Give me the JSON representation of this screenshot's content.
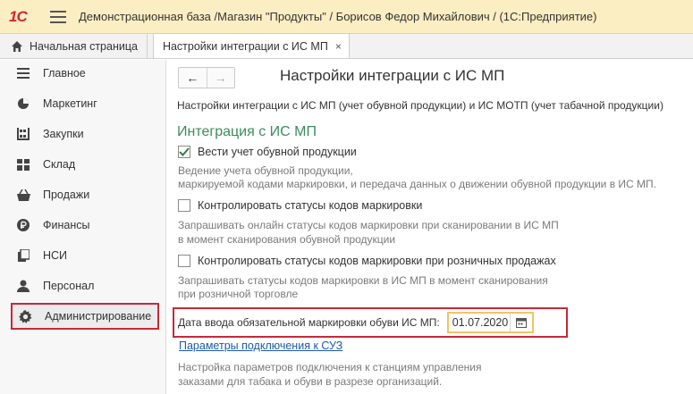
{
  "titlebar": {
    "logo": "1С",
    "title": "Демонстрационная база /Магазин \"Продукты\" / Борисов Федор Михайлович /  (1С:Предприятие)"
  },
  "tabs": {
    "home": "Начальная страница",
    "active": "Настройки интеграции с ИС МП",
    "close": "×"
  },
  "sidebar": {
    "items": [
      {
        "label": "Главное",
        "icon": "menu-lines-icon"
      },
      {
        "label": "Маркетинг",
        "icon": "pie-chart-icon"
      },
      {
        "label": "Закупки",
        "icon": "warehouse-shelves-icon"
      },
      {
        "label": "Склад",
        "icon": "grid-boxes-icon"
      },
      {
        "label": "Продажи",
        "icon": "basket-icon"
      },
      {
        "label": "Финансы",
        "icon": "ruble-coin-icon"
      },
      {
        "label": "НСИ",
        "icon": "documents-icon"
      },
      {
        "label": "Персонал",
        "icon": "person-icon"
      },
      {
        "label": "Администрирование",
        "icon": "gear-icon"
      }
    ],
    "active_index": 8
  },
  "main": {
    "nav_back": "←",
    "nav_forward": "→",
    "title": "Настройки интеграции с ИС МП",
    "description": "Настройки интеграции с ИС МП (учет обувной продукции) и ИС МОТП (учет табачной продукции)",
    "section_title": "Интеграция с ИС МП",
    "options": [
      {
        "label": "Вести учет обувной продукции",
        "checked": true,
        "note1": "Ведение учета обувной продукции,",
        "note2": "маркируемой кодами маркировки, и передача данных о движении обувной продукции в ИС МП."
      },
      {
        "label": "Контролировать статусы кодов маркировки",
        "checked": false,
        "note1": "Запрашивать онлайн статусы кодов маркировки при сканировании в ИС МП",
        "note2": "в момент сканирования обувной продукции"
      },
      {
        "label": "Контролировать статусы кодов маркировки при розничных продажах",
        "checked": false,
        "note1": "Запрашивать статусы кодов маркировки в ИС МП в момент сканирования",
        "note2": "при розничной торговле"
      }
    ],
    "date_label": "Дата ввода обязательной маркировки обуви ИС МП:",
    "date_value": "01.07.2020",
    "link": "Параметры подключения к СУЗ",
    "link_note1": "Настройка параметров подключения к станциям управления",
    "link_note2": "заказами для табака и обуви в разрезе организаций."
  },
  "colors": {
    "titlebar_bg": "#fbeec2",
    "section_green": "#3a8e5c",
    "highlight_red": "#c8283a",
    "field_focus": "#f0c463",
    "link_blue": "#1c5ba8"
  }
}
